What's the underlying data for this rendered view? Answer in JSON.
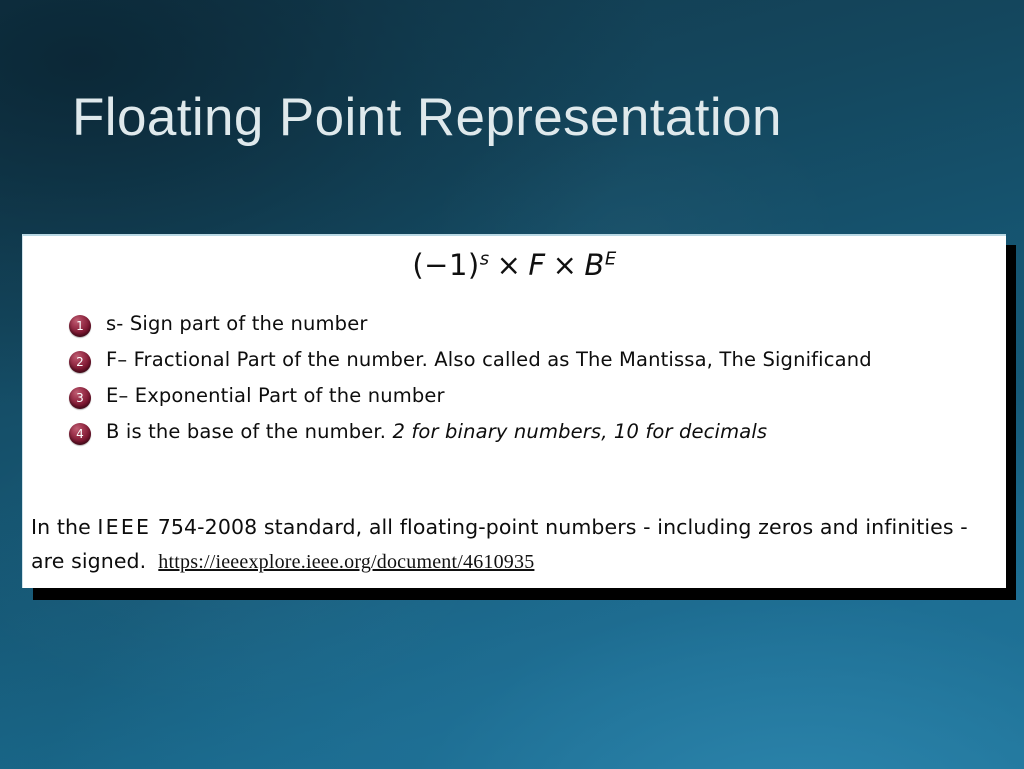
{
  "slide": {
    "title": "Floating Point Representation",
    "background_top_color": "#12394c",
    "background_bottom_color": "#1d7a9e",
    "card_background": "#ffffff",
    "bullet_color": "#7c1630",
    "title_color": "#dfe9ec"
  },
  "formula": {
    "open_paren": "(",
    "minus_one": "−1",
    "close_paren": ")",
    "sign_exponent": "s",
    "times_1": "×",
    "fraction": "F",
    "times_2": "×",
    "base": "B",
    "base_exponent": "E",
    "plain_text": "(−1)^s × F × B^E"
  },
  "list": [
    {
      "number": "1",
      "text": "s- Sign part of the number",
      "italic_tail": ""
    },
    {
      "number": "2",
      "text": "F– Fractional Part of the number. Also called as The Mantissa, The Significand",
      "italic_tail": ""
    },
    {
      "number": "3",
      "text": "E– Exponential Part of the number",
      "italic_tail": ""
    },
    {
      "number": "4",
      "text": "B is the base of the number. ",
      "italic_tail": "2 for binary numbers, 10 for decimals"
    }
  ],
  "footer": {
    "part1": "In the ",
    "ieee": "IEEE",
    "part2": " 754-2008 standard, all floating-point numbers - including zeros and infinities  -  are  signed.",
    "link": "https://ieeexplore.ieee.org/document/4610935"
  }
}
